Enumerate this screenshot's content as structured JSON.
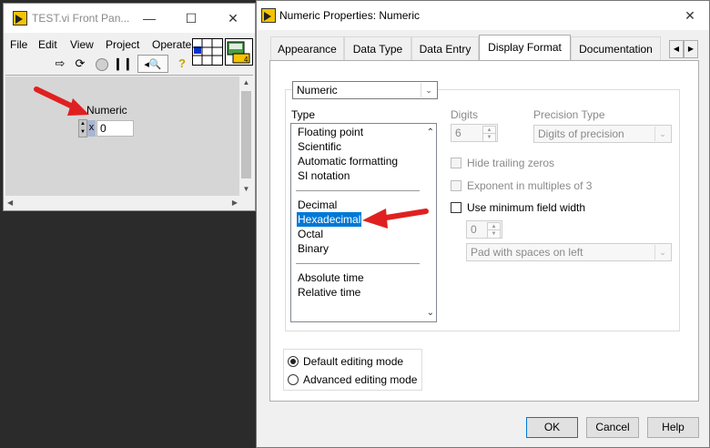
{
  "front_panel": {
    "title": "TEST.vi Front Pan...",
    "menu": [
      "File",
      "Edit",
      "View",
      "Project",
      "Operate"
    ],
    "control": {
      "label": "Numeric",
      "value": "0",
      "radix": "x"
    }
  },
  "dialog": {
    "title": "Numeric Properties: Numeric",
    "tabs": [
      "Appearance",
      "Data Type",
      "Data Entry",
      "Display Format",
      "Documentation"
    ],
    "active_tab": "Display Format",
    "target_select": "Numeric",
    "type_label": "Type",
    "type_items": {
      "group1": [
        "Floating point",
        "Scientific",
        "Automatic formatting",
        "SI notation"
      ],
      "group2": [
        "Decimal",
        "Hexadecimal",
        "Octal",
        "Binary"
      ],
      "group3": [
        "Absolute time",
        "Relative time"
      ]
    },
    "selected_type": "Hexadecimal",
    "digits_label": "Digits",
    "digits_value": "6",
    "precision_type_label": "Precision Type",
    "precision_type_value": "Digits of precision",
    "hide_trailing_zeros": "Hide trailing zeros",
    "exponent_multiples": "Exponent in multiples of 3",
    "use_min_field_width": "Use minimum field width",
    "min_width_value": "0",
    "pad_value": "Pad with spaces on left",
    "editing_modes": [
      "Default editing mode",
      "Advanced editing mode"
    ],
    "buttons": {
      "ok": "OK",
      "cancel": "Cancel",
      "help": "Help"
    }
  },
  "colors": {
    "accent": "#0078d7",
    "arrow": "#e02020",
    "panel_bg": "#d6d6d6"
  }
}
